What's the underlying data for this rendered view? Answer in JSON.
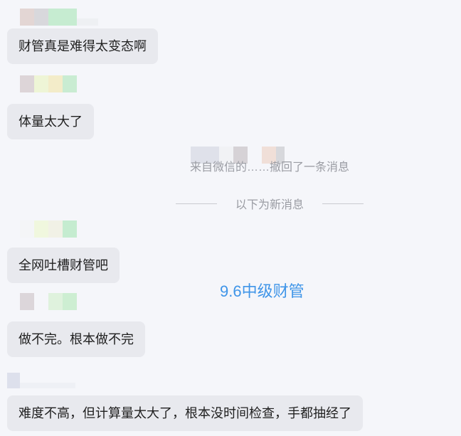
{
  "messages": [
    {
      "text": "财管真是难得太变态啊"
    },
    {
      "text": "体量太大了"
    },
    {
      "text": "全网吐槽财管吧"
    },
    {
      "text": "做不完。根本做不完"
    },
    {
      "text": "难度不高，但计算量太大了，根本没时间检查，手都抽经了"
    }
  ],
  "system": {
    "recall_notice": "来自微信的……撤回了一条消息",
    "new_messages_divider": "以下为新消息"
  },
  "watermark": "9.6中级财管",
  "colors": {
    "background": "#f5f6fa",
    "bubble": "#e8e9ee",
    "watermark": "#3f95e8",
    "system_text": "#9a9ca3"
  }
}
